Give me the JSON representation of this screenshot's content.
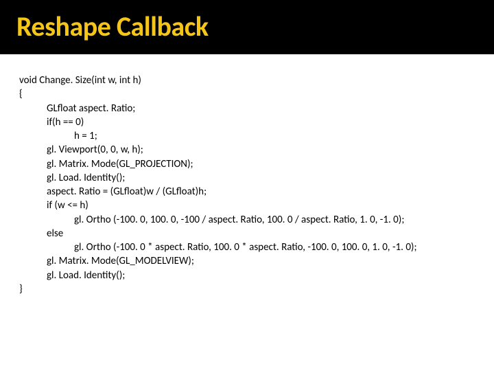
{
  "title": "Reshape Callback",
  "code": {
    "l0": "void Change. Size(int w, int h)",
    "l1": "{",
    "l2": "GLfloat aspect. Ratio;",
    "l3": "if(h == 0)",
    "l4": "h = 1;",
    "l5": "gl. Viewport(0, 0, w, h);",
    "l6": "gl. Matrix. Mode(GL_PROJECTION);",
    "l7": "gl. Load. Identity();",
    "l8": "aspect. Ratio = (GLfloat)w / (GLfloat)h;",
    "l9": "if (w <= h)",
    "l10": "gl. Ortho (-100. 0, 100. 0, -100 / aspect. Ratio, 100. 0 / aspect. Ratio, 1. 0, -1. 0);",
    "l11": "else",
    "l12": "gl. Ortho (-100. 0 * aspect. Ratio, 100. 0 * aspect. Ratio, -100. 0, 100. 0, 1. 0, -1. 0);",
    "l13": "gl. Matrix. Mode(GL_MODELVIEW);",
    "l14": "gl. Load. Identity();",
    "l15": "}"
  }
}
